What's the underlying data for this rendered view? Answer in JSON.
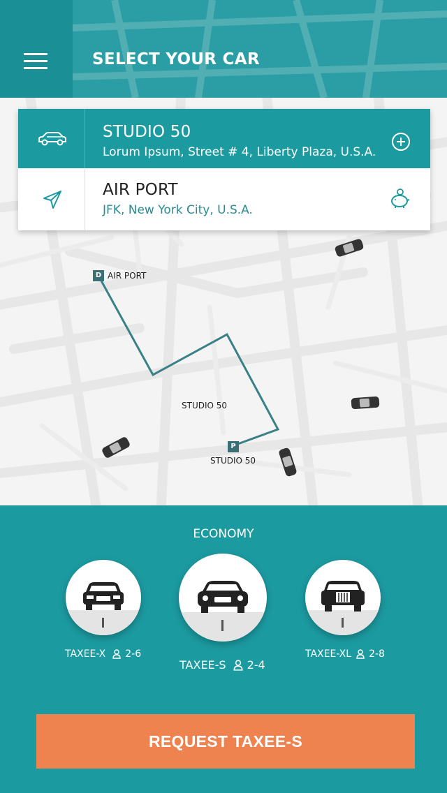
{
  "header": {
    "title": "SELECT YOUR CAR",
    "menu_icon": "hamburger-menu-icon"
  },
  "trip": {
    "pickup": {
      "name": "STUDIO 50",
      "address": "Lorum Ipsum, Street # 4, Liberty Plaza, U.S.A.",
      "icon": "car-icon",
      "action_icon": "add-circle-icon"
    },
    "dropoff": {
      "name": "AIR PORT",
      "address": "JFK, New York City, U.S.A.",
      "icon": "navigation-arrow-icon",
      "action_icon": "piggy-bank-icon"
    }
  },
  "map": {
    "destination_pin": "D",
    "destination_label": "AIR PORT",
    "pickup_pin": "P",
    "pickup_label": "STUDIO 50",
    "area_label": "STUDIO 50"
  },
  "options": {
    "category": "ECONOMY",
    "cars": [
      {
        "name": "TAXEE-X",
        "capacity": "2-6",
        "selected": false
      },
      {
        "name": "TAXEE-S",
        "capacity": "2-4",
        "selected": true
      },
      {
        "name": "TAXEE-XL",
        "capacity": "2-8",
        "selected": false
      }
    ]
  },
  "request_button": "REQUEST TAXEE-S",
  "colors": {
    "primary": "#1b9aa0",
    "header": "#2a9ea4",
    "header_dark": "#1a8f96",
    "accent": "#ee8350",
    "route": "#3a8087",
    "map_bg": "#f4f4f4"
  }
}
